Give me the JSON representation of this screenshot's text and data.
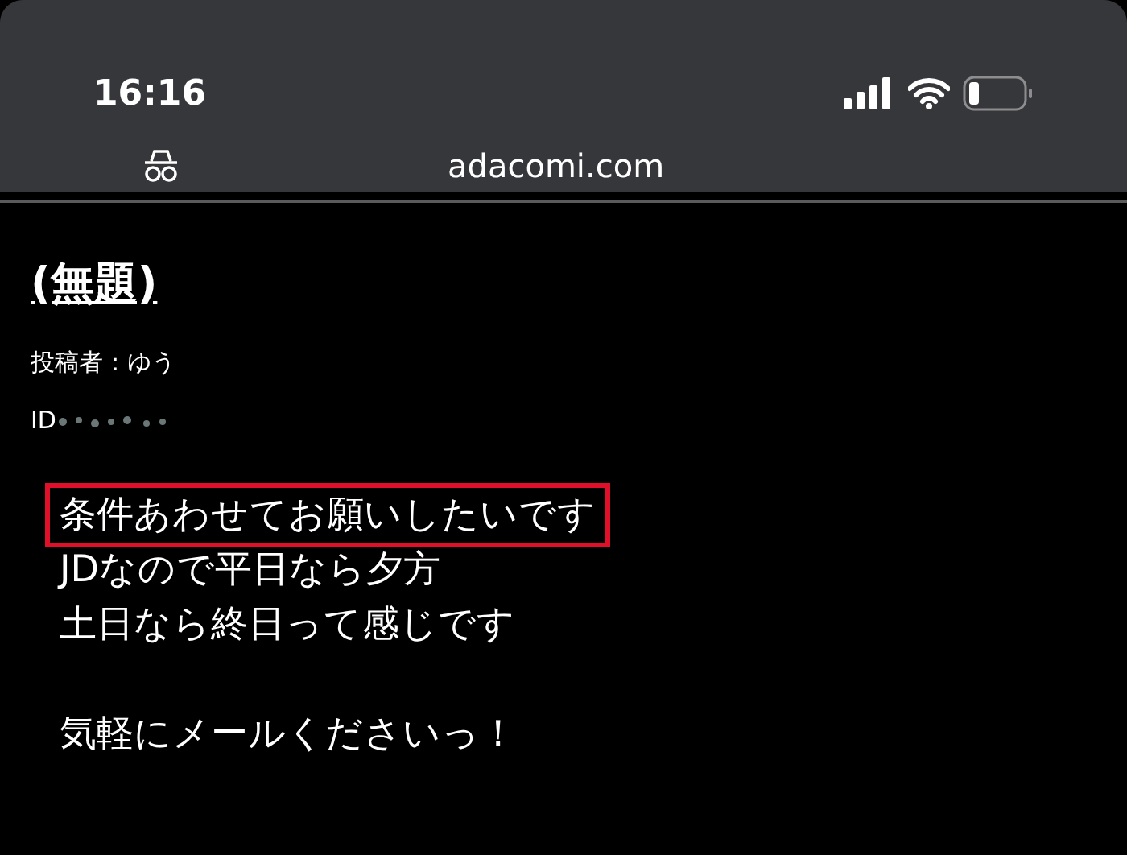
{
  "status_bar": {
    "time": "16:16"
  },
  "address_bar": {
    "url": "adacomi.com"
  },
  "post": {
    "title": "(無題)",
    "author": "投稿者：ゆう",
    "id_label": "ID",
    "paragraphs": [
      {
        "lines": [
          {
            "text": "条件あわせてお願いしたいです",
            "highlighted": true
          },
          {
            "text": "JDなので平日なら夕方",
            "highlighted": false
          },
          {
            "text": "土日なら終日って感じです",
            "highlighted": false
          }
        ]
      },
      {
        "lines": [
          {
            "text": "気軽にメールくださいっ！",
            "highlighted": false
          }
        ]
      }
    ]
  }
}
